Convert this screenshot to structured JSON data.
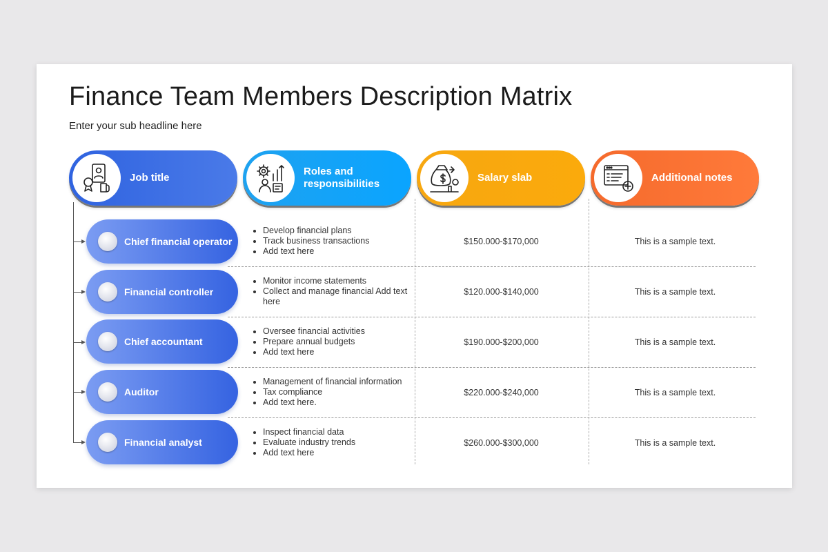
{
  "title": "Finance Team Members Description Matrix",
  "subtitle": "Enter your sub headline here",
  "colors": {
    "job": "#2f63e0",
    "roles": "#0aa4ff",
    "salary": "#fbaa0c",
    "notes": "#ff7a3a"
  },
  "headers": [
    {
      "label": "Job title",
      "icon": "id-badge-icon"
    },
    {
      "label": "Roles and responsibilities",
      "icon": "gear-growth-icon"
    },
    {
      "label": "Salary slab",
      "icon": "money-bag-icon"
    },
    {
      "label": "Additional notes",
      "icon": "browser-add-icon"
    }
  ],
  "rows": [
    {
      "job": "Chief financial operator",
      "roles": [
        "Develop financial plans",
        "Track business transactions",
        "Add text here"
      ],
      "salary": "$150.000-$170,000",
      "note": "This is a sample text."
    },
    {
      "job": "Financial controller",
      "roles": [
        "Monitor income statements",
        "Collect and manage financial Add text here"
      ],
      "salary": "$120.000-$140,000",
      "note": "This is a sample text."
    },
    {
      "job": "Chief accountant",
      "roles": [
        "Oversee financial activities",
        "Prepare annual budgets",
        "Add text here"
      ],
      "salary": "$190.000-$200,000",
      "note": "This is a sample text."
    },
    {
      "job": "Auditor",
      "roles": [
        "Management of financial information",
        "Tax compliance",
        "Add text here."
      ],
      "salary": "$220.000-$240,000",
      "note": "This is a sample text."
    },
    {
      "job": "Financial analyst",
      "roles": [
        "Inspect financial data",
        "Evaluate industry trends",
        "Add text here"
      ],
      "salary": "$260.000-$300,000",
      "note": "This is a sample text."
    }
  ]
}
